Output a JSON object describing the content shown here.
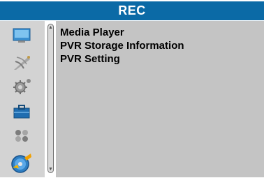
{
  "header": {
    "title": "REC"
  },
  "sidebar": {
    "icons": [
      {
        "name": "picture-monitor-icon"
      },
      {
        "name": "channel-search-satellite-icon"
      },
      {
        "name": "system-settings-gear-icon"
      },
      {
        "name": "toolbox-icon"
      },
      {
        "name": "games-icon"
      },
      {
        "name": "rec-disc-icon",
        "selected": true
      }
    ]
  },
  "menu": {
    "items": [
      {
        "label": "Media Player"
      },
      {
        "label": "PVR Storage Information"
      },
      {
        "label": "PVR Setting"
      }
    ]
  },
  "colors": {
    "title_bar": "#0b6aa6",
    "sidebar_bg": "#d3d3d3",
    "main_bg": "#c4c4c4"
  }
}
